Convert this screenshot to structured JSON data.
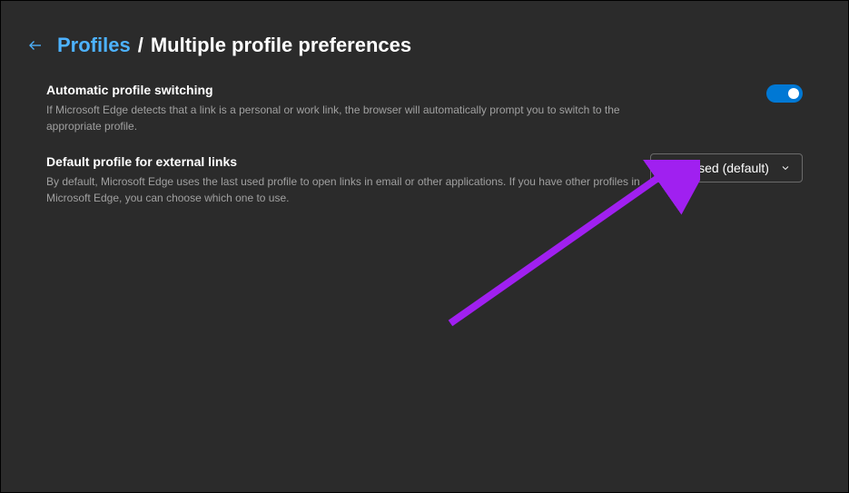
{
  "breadcrumb": {
    "parent": "Profiles",
    "separator": "/",
    "current": "Multiple profile preferences"
  },
  "settings": {
    "auto_switch": {
      "title": "Automatic profile switching",
      "desc": "If Microsoft Edge detects that a link is a personal or work link, the browser will automatically prompt you to switch to the appropriate profile.",
      "enabled": true
    },
    "default_profile": {
      "title": "Default profile for external links",
      "desc": "By default, Microsoft Edge uses the last used profile to open links in email or other applications. If you have other profiles in Microsoft Edge, you can choose which one to use.",
      "selected": "Last used (default)"
    }
  },
  "colors": {
    "accent": "#0078d4",
    "link": "#4db2ff",
    "annotation": "#a020f0"
  }
}
